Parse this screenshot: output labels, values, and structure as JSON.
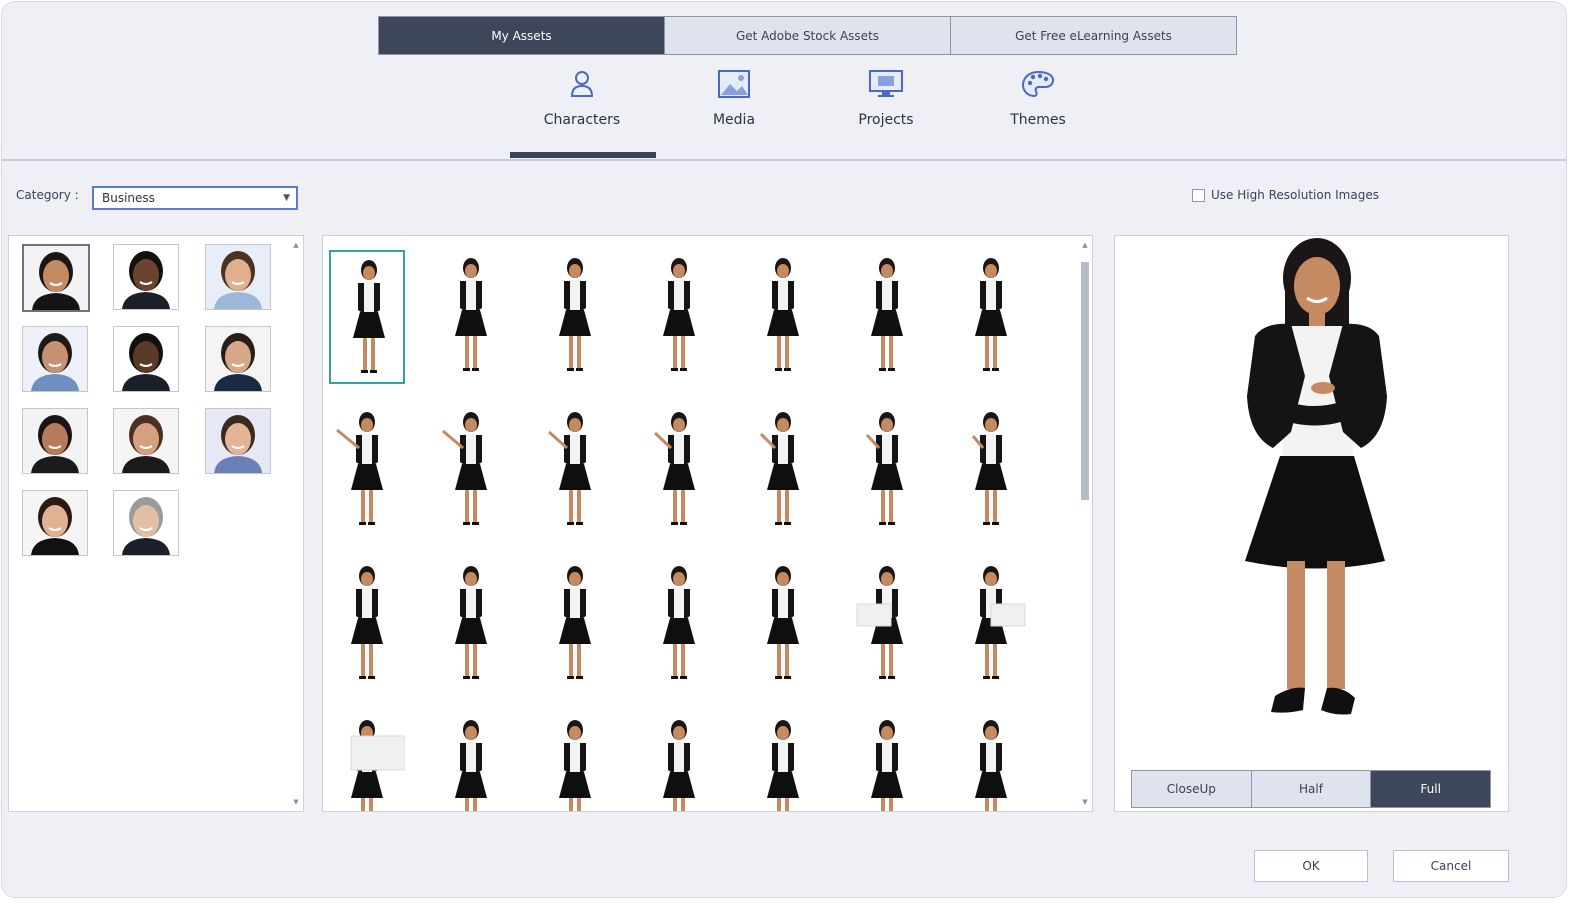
{
  "top_tabs": [
    {
      "label": "My Assets",
      "active": true
    },
    {
      "label": "Get Adobe Stock Assets",
      "active": false
    },
    {
      "label": "Get Free eLearning Assets",
      "active": false
    }
  ],
  "nav": {
    "characters": "Characters",
    "media": "Media",
    "projects": "Projects",
    "themes": "Themes",
    "active": "Characters"
  },
  "category": {
    "label": "Category :",
    "selected": "Business"
  },
  "hires_label": "Use High Resolution Images",
  "view_buttons": [
    {
      "label": "CloseUp",
      "active": false
    },
    {
      "label": "Half",
      "active": false
    },
    {
      "label": "Full",
      "active": true
    }
  ],
  "dialog": {
    "ok": "OK",
    "cancel": "Cancel"
  },
  "colors": {
    "accent_dark": "#3e4659",
    "selection_teal": "#2fa3a3",
    "dropdown_border": "#5a7bd0"
  }
}
